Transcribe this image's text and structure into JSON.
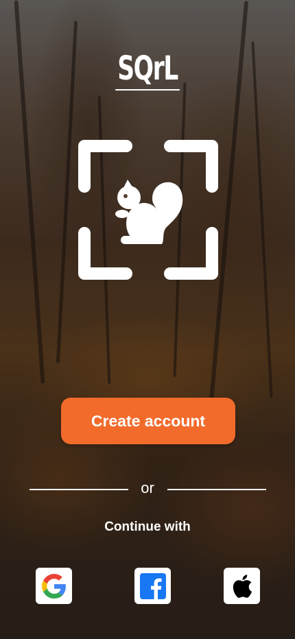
{
  "app": {
    "logo_text": "SQrL"
  },
  "actions": {
    "create_account_label": "Create account",
    "divider_text": "or",
    "continue_with_label": "Continue with"
  },
  "social_buttons": [
    {
      "provider": "Google",
      "icon": "google-icon"
    },
    {
      "provider": "Facebook",
      "icon": "facebook-icon"
    },
    {
      "provider": "Apple",
      "icon": "apple-icon"
    }
  ],
  "colors": {
    "primary_button": "#f26b2b",
    "facebook_blue": "#1877f2",
    "google_blue": "#4285f4",
    "google_red": "#ea4335",
    "google_yellow": "#fbbc05",
    "google_green": "#34a853"
  }
}
